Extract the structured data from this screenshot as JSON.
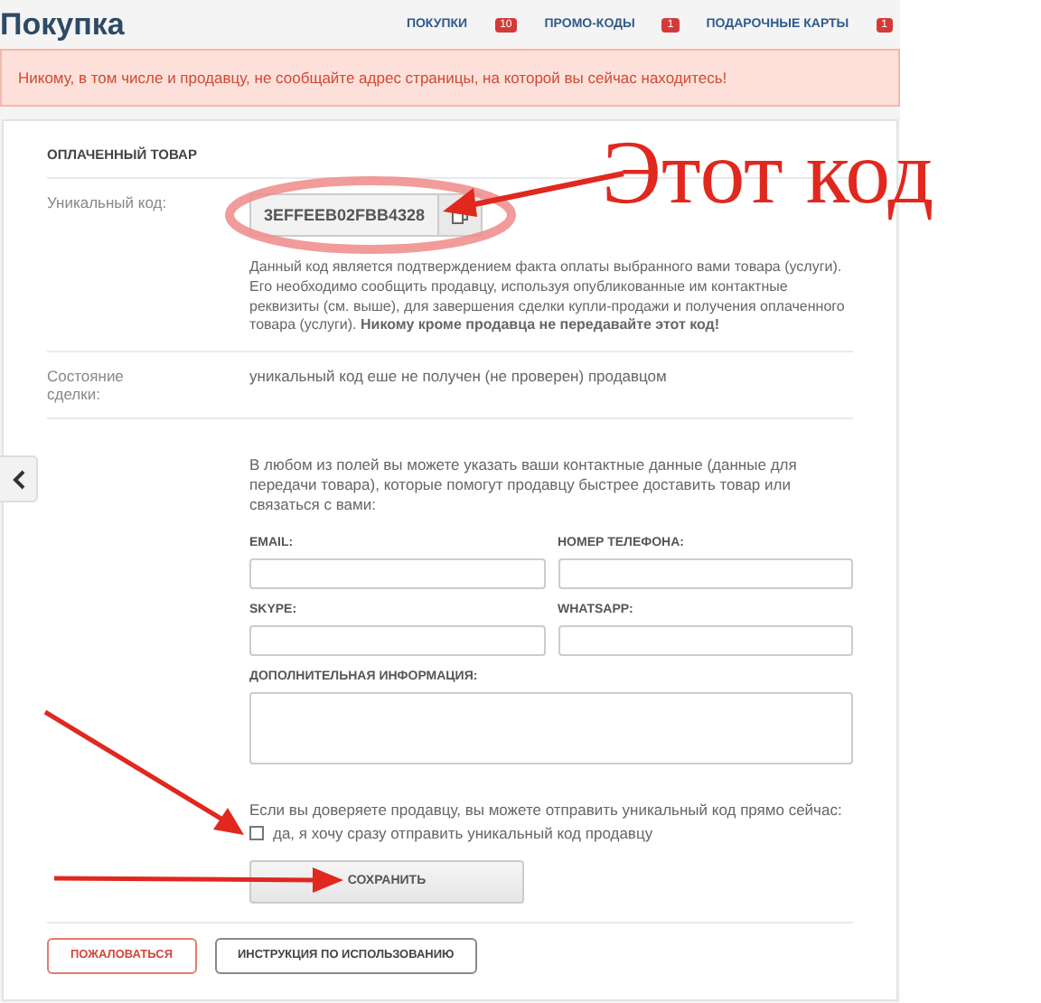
{
  "page": {
    "title": "Покупка"
  },
  "nav": [
    {
      "label": "ПОКУПКИ",
      "badge": "10"
    },
    {
      "label": "ПРОМО-КОДЫ",
      "badge": "1"
    },
    {
      "label": "ПОДАРОЧНЫЕ КАРТЫ",
      "badge": "1"
    }
  ],
  "alert": "Никому, в том числе и продавцу, не сообщайте адрес страницы, на которой вы сейчас находитесь!",
  "section_title": "ОПЛАЧЕННЫЙ ТОВАР",
  "code_row": {
    "label": "Уникальный код:",
    "code": "3EFFEEB02FBB4328",
    "note": "Данный код является подтверждением факта оплаты выбранного вами товара (услуги). Его необходимо сообщить продавцу, используя опубликованные им контактные реквизиты (см. выше), для завершения сделки купли-продажи и получения оплаченного товара (услуги). **Никому кроме продавца не передавайте этот код!**"
  },
  "status_row": {
    "label": "Состояние сделки:",
    "value": "уникальный код еше не получен (не проверен) продавцом"
  },
  "contact_intro": "В любом из полей вы можете указать ваши контактные данные (данные для передачи товара), которые помогут продавцу быстрее доставить товар или связаться с вами:",
  "fields": [
    {
      "label": "EMAIL:",
      "kind": "input"
    },
    {
      "label": "НОМЕР ТЕЛЕФОНА:",
      "kind": "input"
    },
    {
      "label": "SKYPE:",
      "kind": "input"
    },
    {
      "label": "WHATSAPP:",
      "kind": "input"
    },
    {
      "label": "ДОПОЛНИТЕЛЬНАЯ ИНФОРМАЦИЯ:",
      "kind": "textarea"
    }
  ],
  "consent_text": "Если вы доверяете продавцу, вы можете отправить уникальный код прямо сейчас:",
  "consent_checkbox": {
    "label": "да, я хочу сразу отправить уникальный код продавцу",
    "checked": false
  },
  "save_button": "СОХРАНИТЬ",
  "footer_buttons": [
    {
      "label": "ПОЖАЛОВАТЬСЯ",
      "kind": "danger"
    },
    {
      "label": "ИНСТРУКЦИЯ ПО ИСПОЛЬЗОВАНИЮ",
      "kind": "default"
    }
  ],
  "annotation": {
    "text": "Этот код"
  }
}
